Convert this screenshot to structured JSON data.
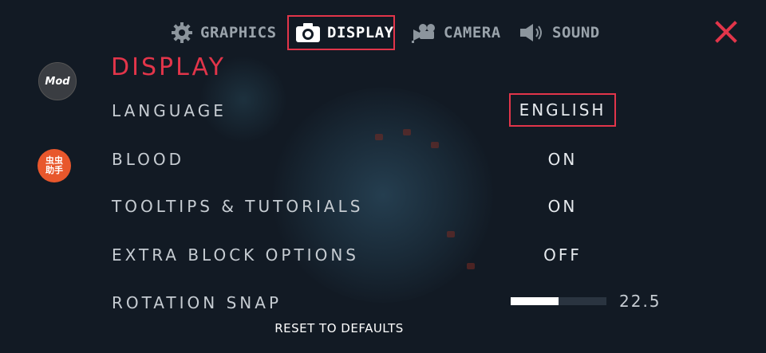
{
  "tabs": [
    {
      "label": "GRAPHICS",
      "icon": "gear-icon",
      "active": false
    },
    {
      "label": "DISPLAY",
      "icon": "camera-icon",
      "active": true
    },
    {
      "label": "CAMERA",
      "icon": "video-camera-icon",
      "active": false
    },
    {
      "label": "SOUND",
      "icon": "speaker-icon",
      "active": false
    }
  ],
  "badges": {
    "mod": "Mod",
    "cc_line1": "虫虫",
    "cc_line2": "助手"
  },
  "section_title": "DISPLAY",
  "settings": [
    {
      "label": "LANGUAGE",
      "value": "ENGLISH"
    },
    {
      "label": "BLOOD",
      "value": "ON"
    },
    {
      "label": "TOOLTIPS & TUTORIALS",
      "value": "ON"
    },
    {
      "label": "EXTRA BLOCK OPTIONS",
      "value": "OFF"
    }
  ],
  "rotation_snap": {
    "label": "ROTATION SNAP",
    "value_text": "22.5",
    "fill_fraction": 0.5
  },
  "reset_label": "RESET TO DEFAULTS",
  "colors": {
    "accent": "#e2354a",
    "background": "#121a24",
    "text": "#c6ccd2"
  }
}
